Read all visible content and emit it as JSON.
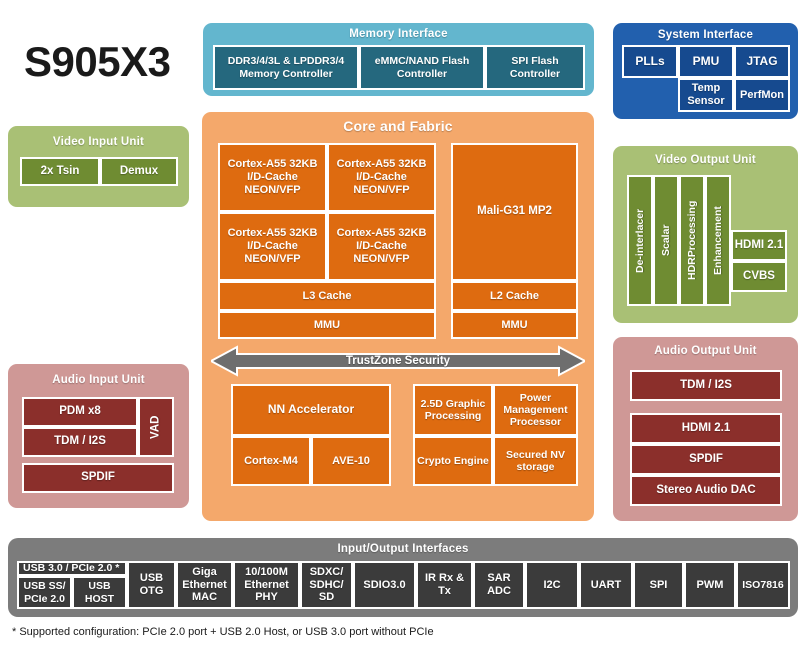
{
  "chip": {
    "title": "S905X3"
  },
  "memory_interface": {
    "title": "Memory Interface",
    "blocks": [
      "DDR3/4/3L & LPDDR3/4 Memory Controller",
      "eMMC/NAND Flash Controller",
      "SPI Flash Controller"
    ]
  },
  "system_interface": {
    "title": "System Interface",
    "blocks": [
      "PLLs",
      "PMU",
      "JTAG",
      "Temp Sensor",
      "PerfMon"
    ]
  },
  "core_fabric": {
    "title": "Core and Fabric",
    "cpu_cores": [
      "Cortex-A55 32KB I/D-Cache NEON/VFP",
      "Cortex-A55 32KB I/D-Cache NEON/VFP",
      "Cortex-A55 32KB I/D-Cache NEON/VFP",
      "Cortex-A55 32KB I/D-Cache NEON/VFP"
    ],
    "l3_cache": "L3 Cache",
    "cpu_mmu": "MMU",
    "gpu": "Mali-G31 MP2",
    "l2_cache": "L2 Cache",
    "gpu_mmu": "MMU",
    "trustzone": "TrustZone Security",
    "nn_accelerator": "NN Accelerator",
    "cortex_m4": "Cortex-M4",
    "ave10": "AVE-10",
    "graphic_2_5d": "2.5D Graphic Processing",
    "power_mgmt": "Power Management Processor",
    "crypto_engine": "Crypto Engine",
    "secured_nv": "Secured NV storage"
  },
  "video_input_unit": {
    "title": "Video Input Unit",
    "blocks": [
      "2x Tsin",
      "Demux"
    ]
  },
  "audio_input_unit": {
    "title": "Audio Input Unit",
    "pdm": "PDM x8",
    "tdm_i2s": "TDM / I2S",
    "vad": "VAD",
    "spdif": "SPDIF"
  },
  "video_output_unit": {
    "title": "Video Output Unit",
    "pipeline": [
      "De-interlacer",
      "Scalar",
      "HDRProcessing",
      "Enhancement"
    ],
    "outputs": [
      "HDMI 2.1",
      "CVBS"
    ]
  },
  "audio_output_unit": {
    "title": "Audio Output Unit",
    "blocks": [
      "TDM / I2S",
      "HDMI 2.1",
      "SPDIF",
      "Stereo Audio DAC"
    ]
  },
  "io_interfaces": {
    "title": "Input/Output Interfaces",
    "usb_pcie_note": "USB 3.0 / PCIe 2.0 *",
    "usb_ss_pcie": "USB SS/ PCIe 2.0",
    "usb_host": "USB HOST",
    "blocks": [
      "USB OTG",
      "Giga Ethernet MAC",
      "10/100M Ethernet PHY",
      "SDXC/ SDHC/ SD",
      "SDIO3.0",
      "IR Rx & Tx",
      "SAR ADC",
      "I2C",
      "UART",
      "SPI",
      "PWM",
      "ISO7816"
    ]
  },
  "footnote": "* Supported configuration: PCIe 2.0 port + USB 2.0  Host, or USB  3.0 port without PCIe",
  "colors": {
    "memory_panel": "#63b6ce",
    "memory_block": "#25687e",
    "system_panel": "#2260ae",
    "system_block": "#164a8f",
    "core_panel": "#f4a86b",
    "core_block": "#de6b10",
    "video_panel": "#a9c075",
    "video_block": "#6f8c32",
    "audio_panel": "#cf9896",
    "audio_block": "#8b2f2b",
    "io_panel": "#7c7c7c",
    "io_block": "#3b3b3b",
    "trustzone_arrow": "#6e6e6e"
  }
}
